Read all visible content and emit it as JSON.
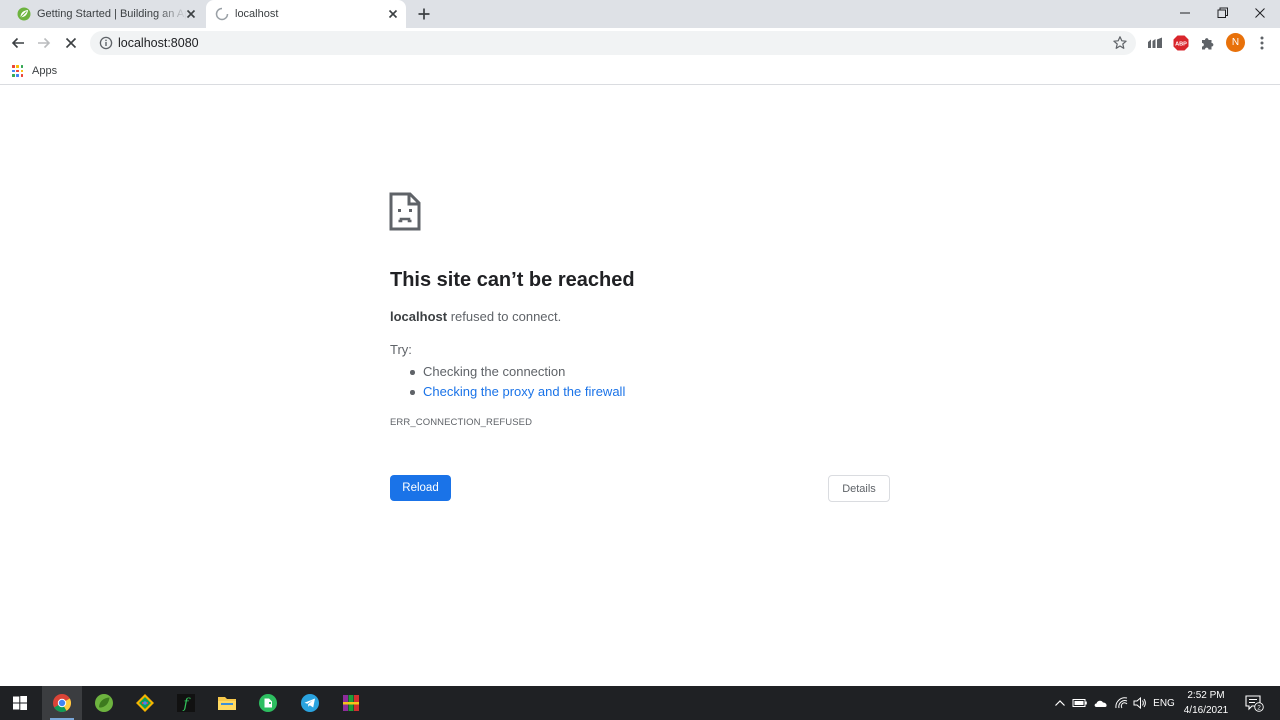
{
  "browser": {
    "tabs": [
      {
        "title": "Getting Started | Building an Application with Spring Boot",
        "active": false
      },
      {
        "title": "localhost",
        "active": true
      }
    ],
    "address": "localhost:8080",
    "bookmarks": {
      "apps_label": "Apps"
    },
    "profile_initial": "N"
  },
  "error_page": {
    "title": "This site can’t be reached",
    "host": "localhost",
    "description_suffix": " refused to connect.",
    "try_label": "Try:",
    "suggestions": [
      {
        "text": "Checking the connection",
        "link": false
      },
      {
        "text": "Checking the proxy and the firewall",
        "link": true
      }
    ],
    "error_code": "ERR_CONNECTION_REFUSED",
    "reload_label": "Reload",
    "details_label": "Details"
  },
  "taskbar": {
    "language": "ENG",
    "time": "2:52 PM",
    "date": "4/16/2021",
    "notification_count": "2"
  },
  "colors": {
    "accent": "#1a73e8",
    "tab_strip": "#dee1e6",
    "taskbar": "#1f2124"
  }
}
